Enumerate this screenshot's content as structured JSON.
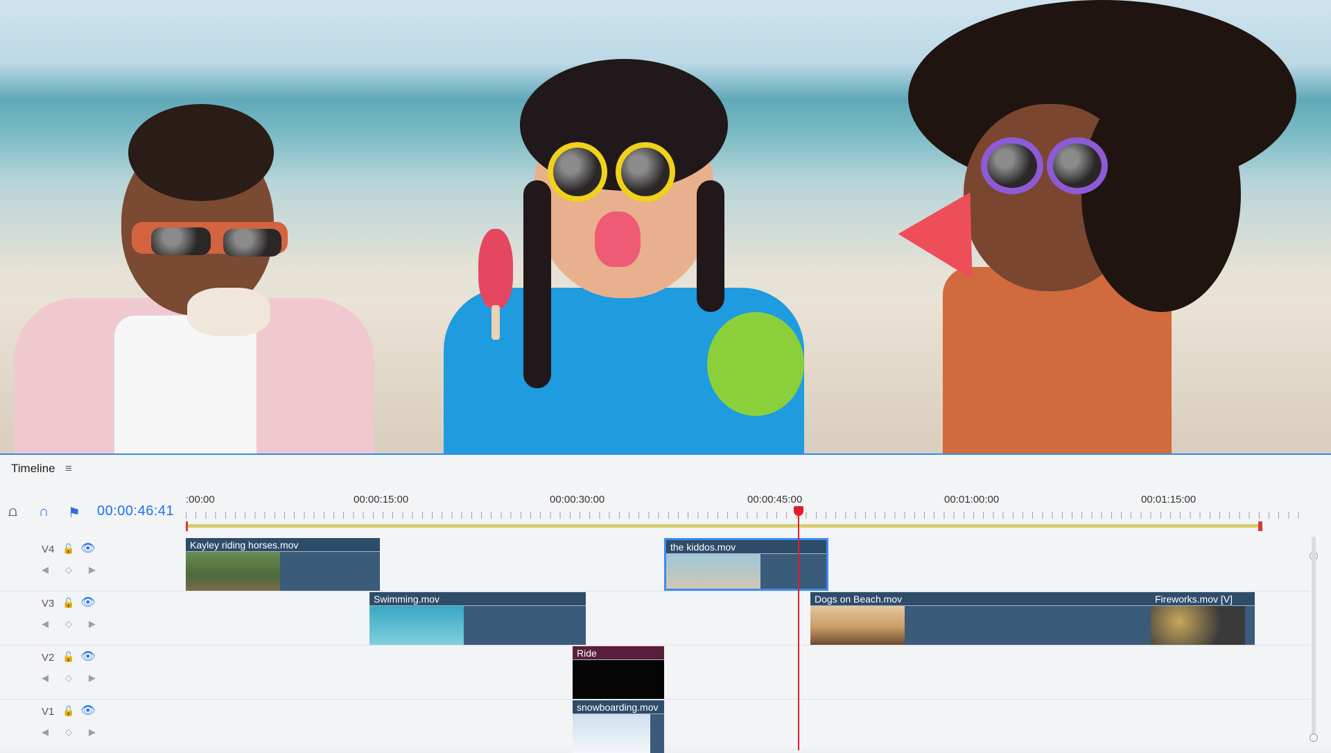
{
  "timeline": {
    "title": "Timeline",
    "menu_icon": "hamburger-icon",
    "timecode": "00:00:46:41",
    "tools": [
      "insert-track-icon",
      "snap-magnet-icon",
      "marker-flag-icon"
    ],
    "ruler_labels": [
      ":00:00",
      "00:00:15:00",
      "00:00:30:00",
      "00:00:45:00",
      "00:01:00:00",
      "00:01:15:00"
    ],
    "tracks": [
      {
        "name": "V4",
        "clips": [
          {
            "label": "Kayley riding horses.mov"
          },
          {
            "label": "the kiddos.mov",
            "selected": true
          }
        ]
      },
      {
        "name": "V3",
        "clips": [
          {
            "label": "Swimming.mov"
          },
          {
            "label": "Dogs on Beach.mov"
          },
          {
            "label": "Fireworks.mov [V]"
          }
        ]
      },
      {
        "name": "V2",
        "clips": [
          {
            "label": "Ride"
          }
        ]
      },
      {
        "name": "V1",
        "clips": [
          {
            "label": "snowboarding.mov"
          }
        ]
      }
    ]
  },
  "colors": {
    "accent": "#1a73e8",
    "playhead": "#e01d2f",
    "clip": "#3b5b7a",
    "work_area": "#d8cc6b"
  }
}
